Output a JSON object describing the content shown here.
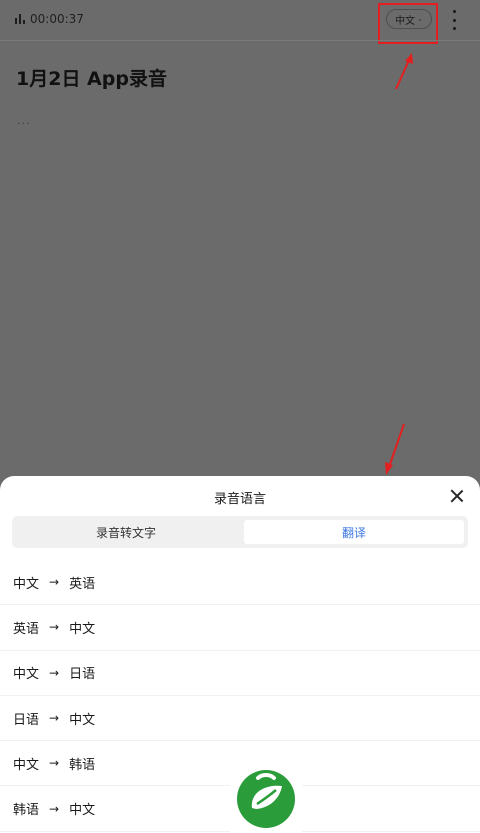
{
  "status": {
    "timer": "00:00:37"
  },
  "header": {
    "language_pill": "中文",
    "chevron": "chevron-down-icon",
    "more": "more-vertical-icon"
  },
  "document": {
    "title": "1月2日 App录音",
    "placeholder": "..."
  },
  "sheet": {
    "title": "录音语言",
    "tabs": [
      {
        "label": "录音转文字",
        "active": false
      },
      {
        "label": "翻译",
        "active": true
      }
    ],
    "options": [
      {
        "from": "中文",
        "to": "英语"
      },
      {
        "from": "英语",
        "to": "中文"
      },
      {
        "from": "中文",
        "to": "日语"
      },
      {
        "from": "日语",
        "to": "中文"
      },
      {
        "from": "中文",
        "to": "韩语"
      },
      {
        "from": "韩语",
        "to": "中文"
      }
    ],
    "arrow_glyph": "→"
  },
  "colors": {
    "accent": "#3c78e0",
    "annotation": "#e41f1f",
    "logo_green": "#2a9d3a"
  }
}
